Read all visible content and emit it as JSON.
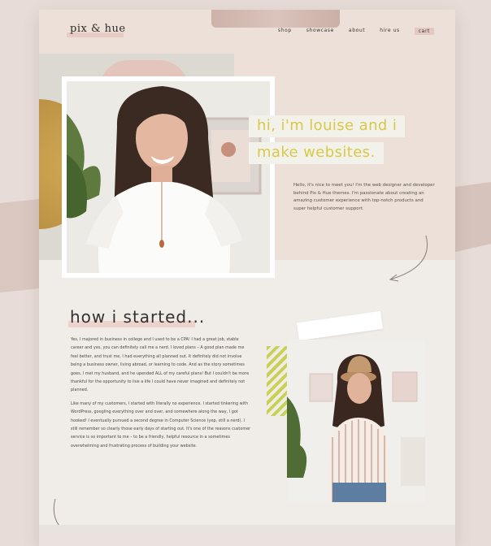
{
  "site": {
    "logo": "pix & hue",
    "nav": [
      "shop",
      "showcase",
      "about",
      "hire us",
      "cart"
    ]
  },
  "hero": {
    "headline_line1": "hi, i'm louise and i",
    "headline_line2": "make websites.",
    "intro": "Hello, it's nice to meet you! I'm the web designer and developer behind Pix & Hue themes. I'm passionate about creating an amazing customer experience with top-notch products and super helpful customer support."
  },
  "story": {
    "title": "how i started...",
    "paragraph1": "Yes, I majored in business in college and I used to be a CPA! I had a great job, stable career and yes, you can definitely call me a nerd. I loved plans – A good plan made me feel better, and trust me, I had everything all planned out. It definitely did not involve being a business owner, living abroad, or learning to code. And as the story sometimes goes, I met my husband, and he upended ALL of my careful plans! But I couldn't be more thankful for the opportunity to live a life I could have never imagined and definitely not planned.",
    "paragraph2": "Like many of my customers, I started with literally no experience. I started tinkering with WordPress, googling everything over and over, and somewhere along the way, I got hooked! I eventually pursued a second degree in Computer Science (yep, still a nerd). I still remember so clearly those early days of starting out. It's one of the reasons customer service is so important to me – to be a friendly, helpful resource in a sometimes overwhelming and frustrating process of building your website."
  },
  "colors": {
    "accent_yellow": "#d8c84a",
    "blush": "#ecd3cc",
    "background": "#e7dcd7",
    "gold": "#cfa446"
  }
}
